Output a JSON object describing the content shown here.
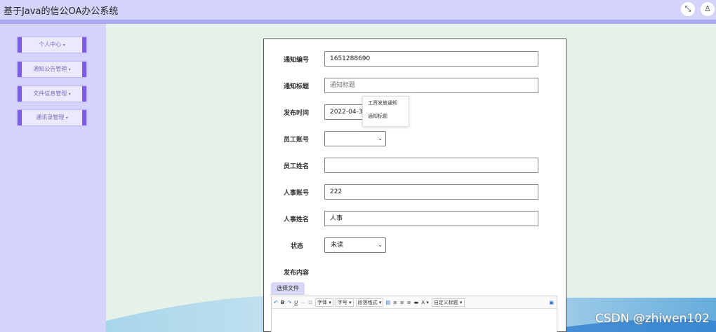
{
  "app": {
    "title": "基于Java的信公OA办公系统"
  },
  "header": {
    "fullscreen_icon": "fullscreen-exit-icon",
    "user_icon": "user-icon"
  },
  "sidebar": {
    "items": [
      {
        "label": "个人中心"
      },
      {
        "label": "通知公告管理"
      },
      {
        "label": "文件信息管理"
      },
      {
        "label": "通讯录管理"
      }
    ]
  },
  "form": {
    "notice_no": {
      "label": "通知编号",
      "value": "1651288690"
    },
    "notice_title": {
      "label": "通知标题",
      "placeholder": "通知标题"
    },
    "publish_time": {
      "label": "发布时间",
      "value": "2022-04-30"
    },
    "employee_account": {
      "label": "员工账号",
      "value": ""
    },
    "employee_name": {
      "label": "员工姓名",
      "value": ""
    },
    "hr_account": {
      "label": "人事账号",
      "value": "222"
    },
    "hr_name": {
      "label": "人事姓名",
      "value": "人事"
    },
    "status": {
      "label": "状态",
      "value": "未读"
    },
    "content": {
      "label": "发布内容"
    }
  },
  "autocomplete": {
    "options": [
      "工资发放通知",
      "通知标题"
    ]
  },
  "editor": {
    "file_button": "选择文件",
    "toolbar": {
      "font_family": "字体",
      "font_size": "字号",
      "paragraph": "段落格式",
      "custom_title": "自定义标题"
    }
  },
  "watermark": "CSDN @zhiwen102"
}
